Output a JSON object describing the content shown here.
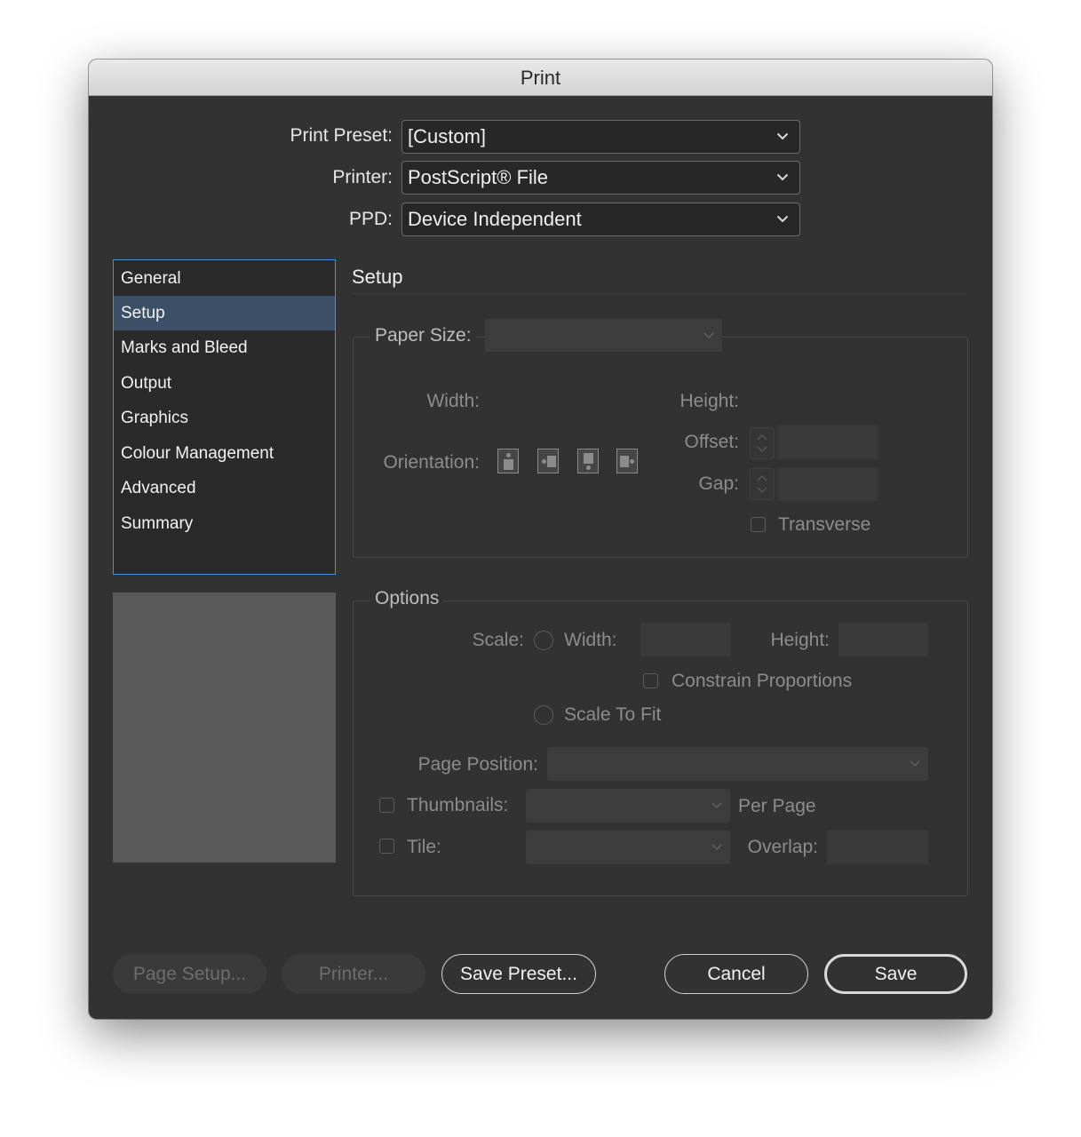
{
  "window": {
    "title": "Print"
  },
  "top": {
    "preset_label": "Print Preset:",
    "preset_value": "[Custom]",
    "printer_label": "Printer:",
    "printer_value": "PostScript® File",
    "ppd_label": "PPD:",
    "ppd_value": "Device Independent"
  },
  "sidebar": {
    "items": [
      {
        "label": "General"
      },
      {
        "label": "Setup",
        "selected": true
      },
      {
        "label": "Marks and Bleed"
      },
      {
        "label": "Output"
      },
      {
        "label": "Graphics"
      },
      {
        "label": "Colour Management"
      },
      {
        "label": "Advanced"
      },
      {
        "label": "Summary"
      }
    ]
  },
  "setup": {
    "title": "Setup",
    "paper_size_label": "Paper Size:",
    "width_label": "Width:",
    "height_label": "Height:",
    "orientation_label": "Orientation:",
    "offset_label": "Offset:",
    "gap_label": "Gap:",
    "transverse_label": "Transverse"
  },
  "options": {
    "legend": "Options",
    "scale_label": "Scale:",
    "width_label": "Width:",
    "height_label": "Height:",
    "constrain_label": "Constrain Proportions",
    "scale_to_fit_label": "Scale To Fit",
    "page_position_label": "Page Position:",
    "thumbnails_label": "Thumbnails:",
    "per_page_label": "Per Page",
    "tile_label": "Tile:",
    "overlap_label": "Overlap:"
  },
  "buttons": {
    "page_setup": "Page Setup...",
    "printer": "Printer...",
    "save_preset": "Save Preset...",
    "cancel": "Cancel",
    "save": "Save"
  },
  "colors": {
    "dialog_bg": "#323232",
    "selection": "#3b4f66",
    "focus_ring": "#4b8fd8"
  }
}
